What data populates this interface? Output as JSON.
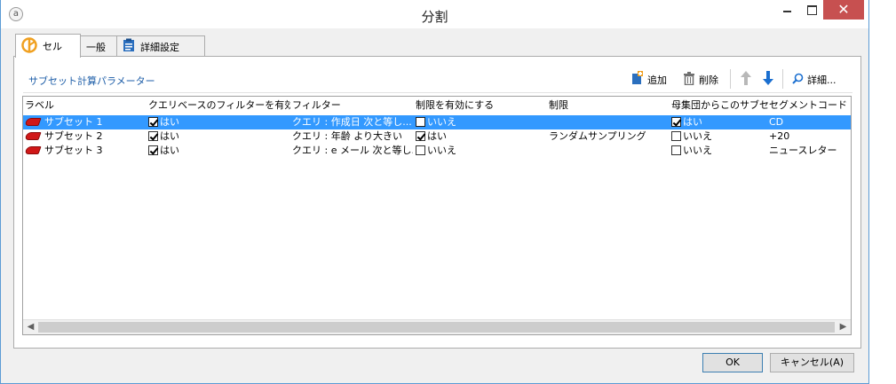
{
  "window": {
    "title": "分割",
    "close_glyph": "✕",
    "app_icon_glyph": "a"
  },
  "tabs": [
    {
      "label": "セル",
      "active": true
    },
    {
      "label": "一般",
      "active": false
    },
    {
      "label": "詳細設定",
      "active": false
    }
  ],
  "section": {
    "title": "サブセット計算パラメーター"
  },
  "toolbar": {
    "add_label": "追加",
    "delete_label": "削除",
    "detail_label": "詳細..."
  },
  "grid": {
    "columns": [
      "ラベル",
      "クエリベースのフィルターを有効化",
      "フィルター",
      "制限を有効にする",
      "制限",
      "母集団からこのサブセ...",
      "セグメントコード"
    ],
    "rows": [
      {
        "label": "サブセット 1",
        "filter_enabled": true,
        "filter_enabled_text": "はい",
        "filter": "クエリ : 作成日 次と等し...",
        "limit_enabled": false,
        "limit_enabled_text": "いいえ",
        "limit": "",
        "exclude": true,
        "exclude_text": "はい",
        "segment": "CD",
        "selected": true
      },
      {
        "label": "サブセット 2",
        "filter_enabled": true,
        "filter_enabled_text": "はい",
        "filter": "クエリ : 年齢 より大きい",
        "limit_enabled": true,
        "limit_enabled_text": "はい",
        "limit": "ランダムサンプリング",
        "exclude": false,
        "exclude_text": "いいえ",
        "segment": "+20",
        "selected": false
      },
      {
        "label": "サブセット 3",
        "filter_enabled": true,
        "filter_enabled_text": "はい",
        "filter": "クエリ : e メール 次と等し...",
        "limit_enabled": false,
        "limit_enabled_text": "いいえ",
        "limit": "",
        "exclude": false,
        "exclude_text": "いいえ",
        "segment": "ニュースレター",
        "selected": false
      }
    ]
  },
  "buttons": {
    "ok": "OK",
    "cancel": "キャンセル(A)"
  },
  "colors": {
    "selection": "#3399ff",
    "close": "#c75050",
    "section_title": "#1e5ea8",
    "arrow_up": "#b8b8b8",
    "arrow_down": "#1b6fd0"
  },
  "icons": [
    "segment-cell-icon",
    "clipboard-icon",
    "add-icon",
    "trash-icon",
    "arrow-up-icon",
    "arrow-down-icon",
    "search-icon",
    "subset-icon"
  ]
}
